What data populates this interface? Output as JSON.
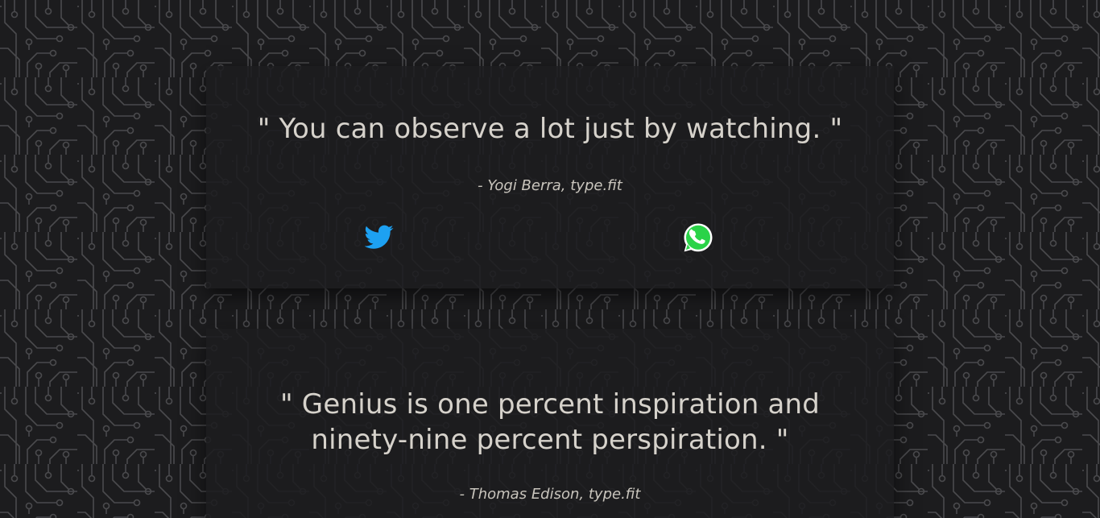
{
  "colors": {
    "background": "#1c1c1e",
    "circuit_trace": "#4a4a4d",
    "card_background": "#1c1c1e",
    "quote_text": "#d6d2cb",
    "author_text": "#c9c5bd",
    "twitter_brand": "#1da1f2",
    "whatsapp_brand": "#2ad348"
  },
  "quotes": [
    {
      "text": "\" You can observe a lot just by watching. \"",
      "author": "- Yogi Berra, type.fit",
      "share": {
        "twitter_icon": "twitter-bird-icon",
        "whatsapp_icon": "whatsapp-icon"
      }
    },
    {
      "text": "\" Genius is one percent inspiration and ninety-nine percent perspiration. \"",
      "author": "- Thomas Edison, type.fit"
    }
  ]
}
